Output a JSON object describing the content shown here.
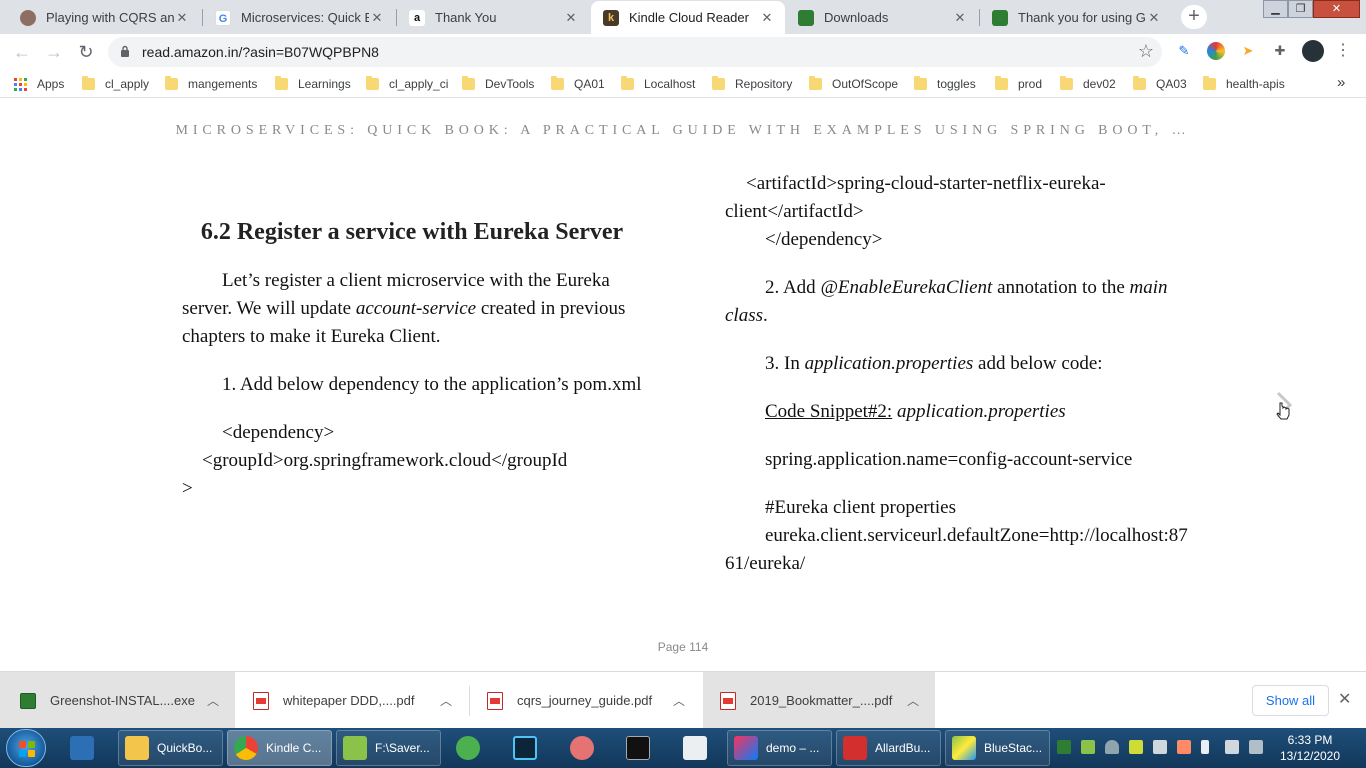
{
  "browser": {
    "tabs": [
      {
        "title": "Playing with CQRS and E",
        "icon": "avatar-icon",
        "active": false
      },
      {
        "title": "Microservices: Quick Boo",
        "icon": "google-icon",
        "active": false
      },
      {
        "title": "Thank You",
        "icon": "amazon-icon",
        "active": false
      },
      {
        "title": "Kindle Cloud Reader",
        "icon": "kindle-icon",
        "active": true
      },
      {
        "title": "Downloads",
        "icon": "greenshot-icon",
        "active": false
      },
      {
        "title": "Thank you for using Gre",
        "icon": "greenshot-icon",
        "active": false
      }
    ],
    "new_tab_label": "+",
    "url": "read.amazon.in/?asin=B07WQPBPN8"
  },
  "bookmarks": [
    {
      "label": "Apps",
      "icon": "apps-grid-icon"
    },
    {
      "label": "cl_apply",
      "icon": "folder-icon"
    },
    {
      "label": "mangements",
      "icon": "folder-icon"
    },
    {
      "label": "Learnings",
      "icon": "folder-icon"
    },
    {
      "label": "cl_apply_ci",
      "icon": "folder-icon"
    },
    {
      "label": "DevTools",
      "icon": "folder-icon"
    },
    {
      "label": "QA01",
      "icon": "folder-icon"
    },
    {
      "label": "Localhost",
      "icon": "folder-icon"
    },
    {
      "label": "Repository",
      "icon": "folder-icon"
    },
    {
      "label": "OutOfScope",
      "icon": "folder-icon"
    },
    {
      "label": "toggles",
      "icon": "folder-icon"
    },
    {
      "label": "prod",
      "icon": "folder-icon"
    },
    {
      "label": "dev02",
      "icon": "folder-icon"
    },
    {
      "label": "QA03",
      "icon": "folder-icon"
    },
    {
      "label": "health-apis",
      "icon": "folder-icon"
    }
  ],
  "bookmarks_overflow": "»",
  "reader": {
    "book_title": "MICROSERVICES: QUICK BOOK: A PRACTICAL GUIDE WITH EXAMPLES USING SPRING BOOT, …",
    "heading": "6.2 Register a service with Eureka Server",
    "left": {
      "p1_a": "Let’s register a client microservice with the Eureka server. We will update ",
      "p1_em": "account-service",
      "p1_b": " created in previous chapters to make it Eureka Client.",
      "p2": "1. Add below dependency to the application’s pom.xml",
      "code_1": "<dependency>",
      "code_2": "<groupId>org.springframework.cloud</groupId",
      "code_3": ">"
    },
    "right": {
      "code_1": "<artifactId>spring-cloud-starter-netflix-eureka-client</artifactId>",
      "code_2": "</dependency>",
      "step2_a": "2. Add ",
      "step2_em1": "@EnableEurekaClient",
      "step2_b": " annotation to the ",
      "step2_em2": "main class",
      "step2_c": ".",
      "step3_a": "3. In ",
      "step3_em": "application.properties",
      "step3_b": " add below code:",
      "snippet_label": "Code Snippet#2:",
      "snippet_name": " application.properties",
      "prop1": "spring.application.name=config-account-service",
      "comment": "#Eureka client properties",
      "prop2": "eureka.client.serviceurl.defaultZone=http://localhost:8761/eureka/"
    },
    "page_label": "Page 114"
  },
  "downloads": [
    {
      "name": "Greenshot-INSTAL....exe",
      "type": "exe"
    },
    {
      "name": "whitepaper DDD,....pdf",
      "type": "pdf"
    },
    {
      "name": "cqrs_journey_guide.pdf",
      "type": "pdf"
    },
    {
      "name": "2019_Bookmatter_....pdf",
      "type": "pdf"
    }
  ],
  "downloads_show_all": "Show all",
  "taskbar": {
    "items": [
      {
        "label": "",
        "icon": "app-icon"
      },
      {
        "label": "QuickBo...",
        "icon": "folder-icon"
      },
      {
        "label": "Kindle C...",
        "icon": "chrome-icon"
      },
      {
        "label": "F:\\Saver...",
        "icon": "editor-icon"
      },
      {
        "label": "",
        "icon": "timer-icon"
      },
      {
        "label": "",
        "icon": "app-icon"
      },
      {
        "label": "",
        "icon": "snipping-icon"
      },
      {
        "label": "",
        "icon": "cmd-icon"
      },
      {
        "label": "",
        "icon": "calculator-icon"
      },
      {
        "label": "demo – ...",
        "icon": "intellij-icon"
      },
      {
        "label": "AllardBu...",
        "icon": "pdf-icon"
      },
      {
        "label": "BlueStac...",
        "icon": "bluestacks-icon"
      }
    ],
    "time": "6:33 PM",
    "date": "13/12/2020"
  },
  "colors": {
    "tab_strip": "#dee1e6",
    "link_blue": "#1a73e8",
    "taskbar": "#1e4f7a",
    "folder": "#f8d775",
    "title_gray": "#8a8a8a"
  }
}
